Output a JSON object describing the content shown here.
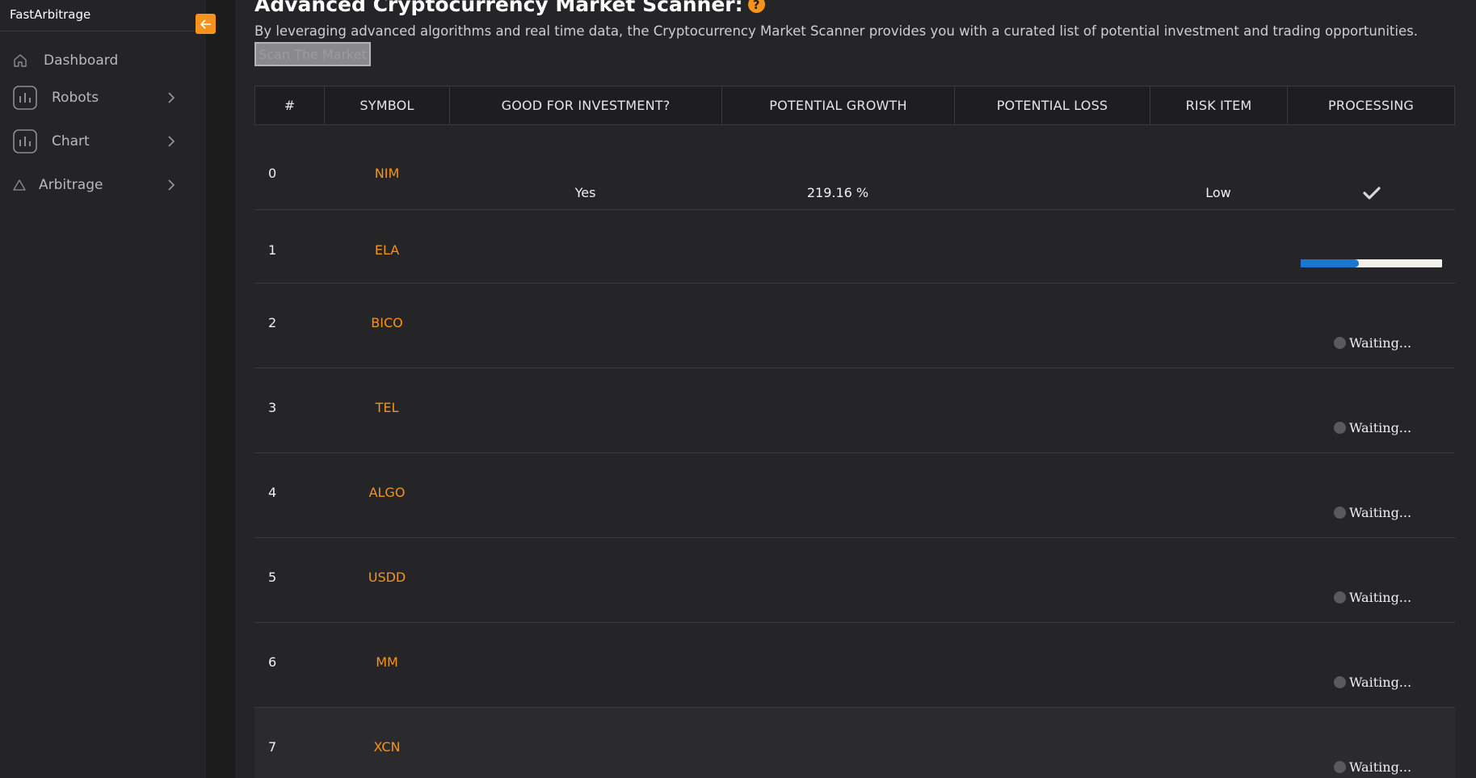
{
  "app": {
    "brand": "FastArbitrage",
    "accent": "#f7931a"
  },
  "sidebar": {
    "items": [
      {
        "label": "Dashboard",
        "icon": "home-icon",
        "has_chevron": false
      },
      {
        "label": "Robots",
        "icon": "bar-chart-icon",
        "has_chevron": true
      },
      {
        "label": "Chart",
        "icon": "bar-chart-icon",
        "has_chevron": true
      },
      {
        "label": "Arbitrage",
        "icon": "triangle-icon",
        "has_chevron": true
      }
    ]
  },
  "page": {
    "title": "Advanced Cryptocurrency Market Scanner:",
    "description": "By leveraging advanced algorithms and real time data, the Cryptocurrency Market Scanner provides you with a curated list of potential investment and trading opportunities.",
    "scan_button": "Scan The Market"
  },
  "table": {
    "headers": [
      "#",
      "SYMBOL",
      "GOOD FOR INVESTMENT?",
      "POTENTIAL GROWTH",
      "POTENTIAL LOSS",
      "RISK ITEM",
      "PROCESSING"
    ],
    "rows": [
      {
        "index": "0",
        "symbol": "NIM",
        "good": "Yes",
        "growth": "219.16 %",
        "loss": "",
        "risk": "Low",
        "status": "done"
      },
      {
        "index": "1",
        "symbol": "ELA",
        "good": "",
        "growth": "",
        "loss": "",
        "risk": "",
        "status": "progress",
        "progress": 0.41
      },
      {
        "index": "2",
        "symbol": "BICO",
        "good": "",
        "growth": "",
        "loss": "",
        "risk": "",
        "status": "waiting",
        "status_text": "Waiting..."
      },
      {
        "index": "3",
        "symbol": "TEL",
        "good": "",
        "growth": "",
        "loss": "",
        "risk": "",
        "status": "waiting",
        "status_text": "Waiting..."
      },
      {
        "index": "4",
        "symbol": "ALGO",
        "good": "",
        "growth": "",
        "loss": "",
        "risk": "",
        "status": "waiting",
        "status_text": "Waiting..."
      },
      {
        "index": "5",
        "symbol": "USDD",
        "good": "",
        "growth": "",
        "loss": "",
        "risk": "",
        "status": "waiting",
        "status_text": "Waiting..."
      },
      {
        "index": "6",
        "symbol": "MM",
        "good": "",
        "growth": "",
        "loss": "",
        "risk": "",
        "status": "waiting",
        "status_text": "Waiting..."
      },
      {
        "index": "7",
        "symbol": "XCN",
        "good": "",
        "growth": "",
        "loss": "",
        "risk": "",
        "status": "waiting",
        "status_text": "Waiting..."
      }
    ]
  }
}
